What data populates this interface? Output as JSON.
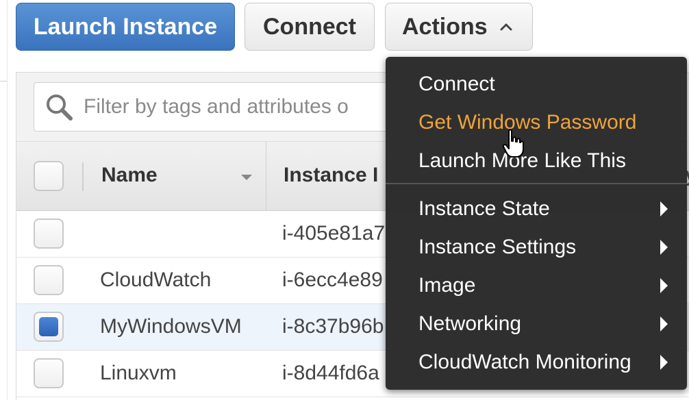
{
  "toolbar": {
    "launch_label": "Launch Instance",
    "connect_label": "Connect",
    "actions_label": "Actions"
  },
  "filter": {
    "placeholder": "Filter by tags and attributes o"
  },
  "table": {
    "columns": {
      "name": "Name",
      "instance_id": "Instance I"
    },
    "rows": [
      {
        "name": "",
        "instance_id": "i-405e81a7",
        "selected": false
      },
      {
        "name": "CloudWatch",
        "instance_id": "i-6ecc4e89",
        "selected": false
      },
      {
        "name": "MyWindowsVM",
        "instance_id": "i-8c37b96b",
        "selected": true
      },
      {
        "name": "Linuxvm",
        "instance_id": "i-8d44fd6a",
        "selected": false
      }
    ],
    "edge_glyph": "y"
  },
  "actions_menu": {
    "items": [
      {
        "label": "Connect",
        "submenu": false,
        "highlighted": false
      },
      {
        "label": "Get Windows Password",
        "submenu": false,
        "highlighted": true
      },
      {
        "label": "Launch More Like This",
        "submenu": false,
        "highlighted": false
      },
      {
        "label": "Instance State",
        "submenu": true,
        "highlighted": false
      },
      {
        "label": "Instance Settings",
        "submenu": true,
        "highlighted": false
      },
      {
        "label": "Image",
        "submenu": true,
        "highlighted": false
      },
      {
        "label": "Networking",
        "submenu": true,
        "highlighted": false
      },
      {
        "label": "CloudWatch Monitoring",
        "submenu": true,
        "highlighted": false
      }
    ]
  },
  "icons": {
    "search": "search-icon",
    "actions_chevron": "chevron-up-icon",
    "submenu_arrow": "chevron-right-icon",
    "cursor": "hand-pointer-icon"
  },
  "colors": {
    "primary_button": "#3a73bd",
    "menu_background": "#262626",
    "menu_highlight": "#f0a33a",
    "selected_checkbox": "#2c62b6"
  }
}
